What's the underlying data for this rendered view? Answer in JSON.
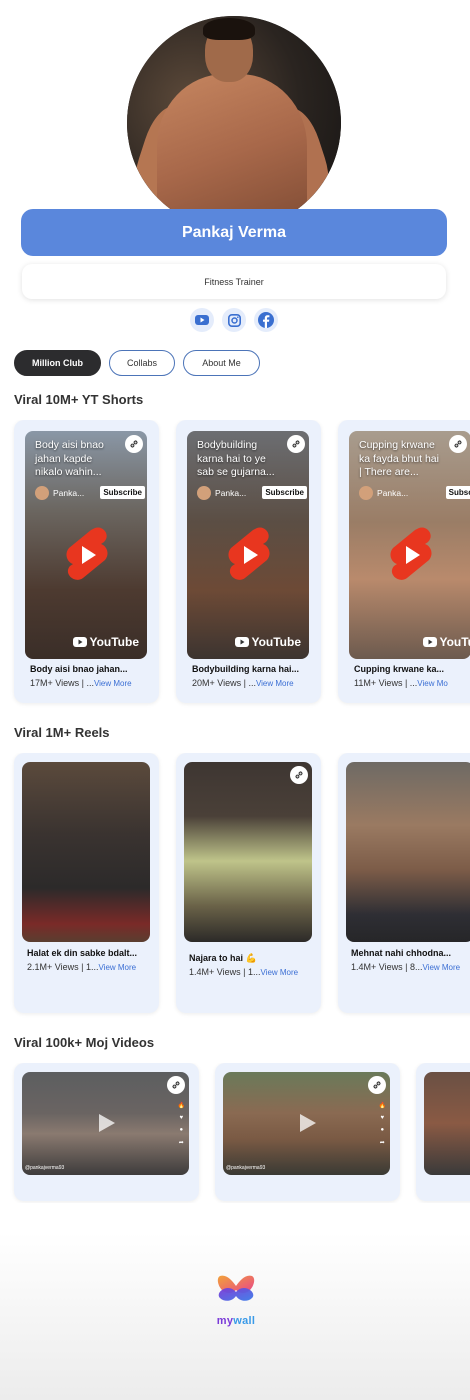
{
  "profile": {
    "name": "Pankaj Verma",
    "role": "Fitness Trainer"
  },
  "socials": [
    {
      "icon": "youtube-icon"
    },
    {
      "icon": "instagram-icon"
    },
    {
      "icon": "facebook-icon"
    }
  ],
  "tabs": [
    {
      "label": "Million Club",
      "active": true
    },
    {
      "label": "Collabs",
      "active": false
    },
    {
      "label": "About Me",
      "active": false
    }
  ],
  "sections": {
    "shorts": {
      "title": "Viral 10M+ YT Shorts",
      "items": [
        {
          "overlay": "Body aisi bnao jahan kapde nikalo wahin...",
          "channel": "Panka...",
          "subscribe": "Subscribe",
          "brand": "YouTube",
          "title": "Body aisi bnao jahan...",
          "views": "17M+ Views | ...",
          "more": "View More"
        },
        {
          "overlay": "Bodybuilding karna hai to ye sab se gujarna...",
          "channel": "Panka...",
          "subscribe": "Subscribe",
          "brand": "YouTube",
          "title": "Bodybuilding karna hai...",
          "views": "20M+ Views | ...",
          "more": "View More"
        },
        {
          "overlay": "Cupping krwane ka fayda bhut hai | There are...",
          "channel": "Panka...",
          "subscribe": "Subscri",
          "brand": "YouTu",
          "title": "Cupping krwane ka...",
          "views": "11M+ Views | ...",
          "more": "View Mo"
        }
      ]
    },
    "reels": {
      "title": "Viral 1M+ Reels",
      "items": [
        {
          "title": "Halat ek din sabke bdalt...",
          "views": "2.1M+ Views | 1...",
          "more": "View More"
        },
        {
          "title": "Najara to hai 💪",
          "views": "1.4M+ Views | 1...",
          "more": "View More"
        },
        {
          "title": "Mehnat nahi chhodna...",
          "views": "1.4M+ Views | 8...",
          "more": "View More"
        }
      ]
    },
    "moj": {
      "title": "Viral 100k+ Moj Videos",
      "items": [
        {
          "handle": "@pankajverma93"
        },
        {
          "handle": "@pankajverma93"
        },
        {
          "handle": ""
        }
      ]
    }
  },
  "brand": {
    "logo_text": "mywall"
  },
  "colors": {
    "accent": "#5a87dc",
    "card_bg": "#ebf1fc",
    "link": "#3b6fd4",
    "shorts_red": "#e8361f"
  }
}
